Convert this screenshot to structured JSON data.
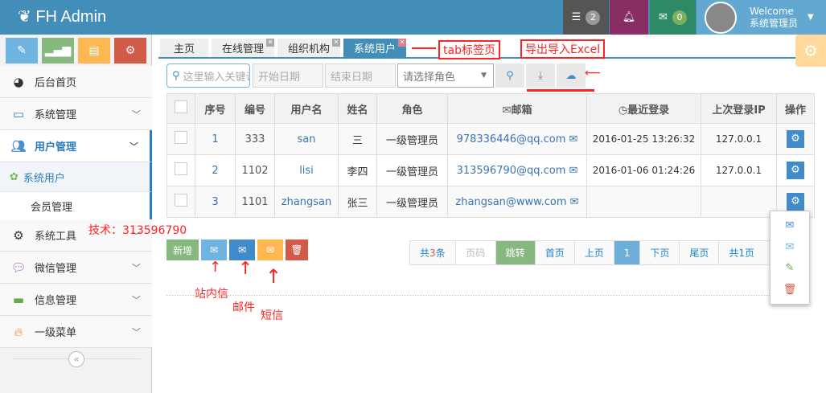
{
  "header": {
    "brand": "FH Admin",
    "tasks_count": "2",
    "messages_count": "0",
    "welcome": "Welcome",
    "user_name": "系统管理员",
    "colors": {
      "bar": "#438eb9",
      "tasks": "#555555",
      "notifications": "#892e65",
      "messages": "#2e8965",
      "user": "#62a8d1"
    }
  },
  "sidebar": {
    "items": [
      {
        "label": "后台首页",
        "icon": "dashboard-icon"
      },
      {
        "label": "系统管理",
        "icon": "desktop-icon"
      },
      {
        "label": "用户管理",
        "icon": "users-icon"
      },
      {
        "label": "系统用户",
        "icon": "group-icon"
      },
      {
        "label": "会员管理"
      },
      {
        "label": "系统工具",
        "icon": "cog-icon"
      },
      {
        "label": "微信管理",
        "icon": "comments-icon"
      },
      {
        "label": "信息管理",
        "icon": "credit-card-icon"
      },
      {
        "label": "一级菜单",
        "icon": "fire-icon"
      }
    ],
    "collapse": "«"
  },
  "tabs": [
    "主页",
    "在线管理",
    "组织机构",
    "系统用户"
  ],
  "toolbar": {
    "search_placeholder": "这里输入关键词",
    "start_date": "开始日期",
    "end_date": "结束日期",
    "role_select": "请选择角色"
  },
  "table": {
    "headers": [
      "序号",
      "编号",
      "用户名",
      "姓名",
      "角色",
      "邮箱",
      "最近登录",
      "上次登录IP",
      "操作"
    ],
    "rows": [
      [
        "1",
        "333",
        "san",
        "三",
        "一级管理员",
        "978336446@qq.com",
        "2016-01-25 13:26:32",
        "127.0.0.1"
      ],
      [
        "2",
        "1102",
        "lisi",
        "李四",
        "一级管理员",
        "313596790@qq.com",
        "2016-01-06 01:24:26",
        "127.0.0.1"
      ],
      [
        "3",
        "1101",
        "zhangsan",
        "张三",
        "一级管理员",
        "zhangsan@www.com",
        "",
        ""
      ]
    ]
  },
  "actions": {
    "add": "新增"
  },
  "pager": {
    "total_pre": "共",
    "total": "3",
    "total_post": "条",
    "page_placeholder": "页码",
    "jump": "跳转",
    "first": "首页",
    "prev": "上页",
    "current": "1",
    "next": "下页",
    "last": "尾页",
    "pages_pre": "共",
    "pages": "1",
    "pages_post": "页"
  },
  "annotations": {
    "tab": "tab标签页",
    "excel": "导出导入Excel",
    "contact": "技术：313596790",
    "inner": "站内信",
    "mail": "邮件",
    "sms": "短信"
  }
}
